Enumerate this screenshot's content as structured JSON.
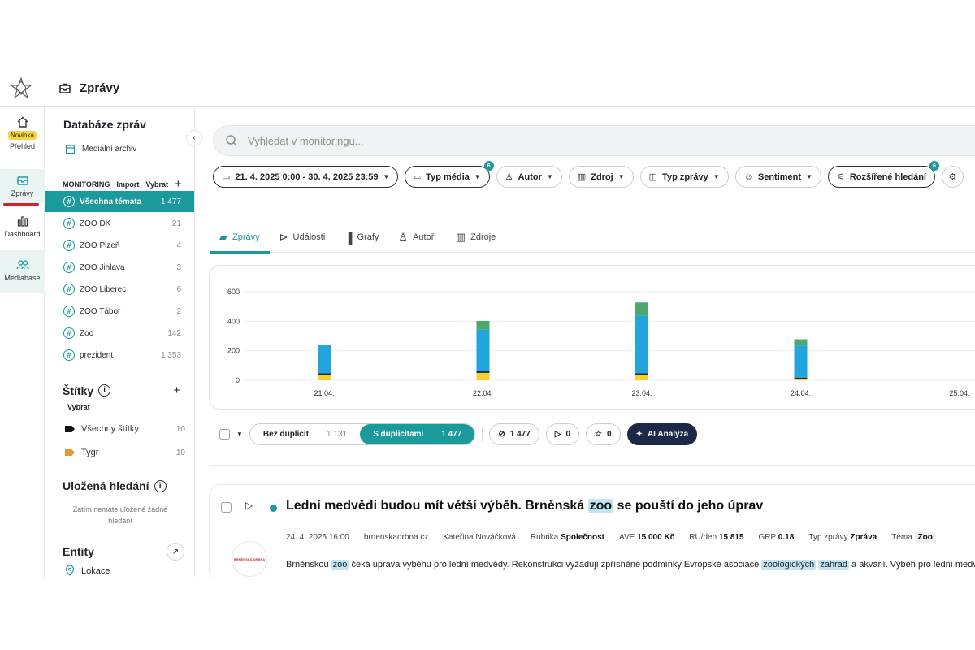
{
  "header": {
    "title": "Zprávy"
  },
  "rail": {
    "overview": {
      "label": "Přehled",
      "badge": "Novinka"
    },
    "messages": {
      "label": "Zprávy"
    },
    "dashboard": {
      "label": "Dashboard"
    },
    "mediabase": {
      "label": "Mediabase"
    }
  },
  "sidebar": {
    "db_title": "Databáze zpráv",
    "media_archive": "Mediální archiv",
    "monitoring_label": "MONITORING",
    "import_label": "Import",
    "select_label": "Vybrat",
    "topics": [
      {
        "label": "Všechna témata",
        "count": "1 477"
      },
      {
        "label": "ZOO DK",
        "count": "21"
      },
      {
        "label": "ZOO Plzeň",
        "count": "4"
      },
      {
        "label": "ZOO Jihlava",
        "count": "3"
      },
      {
        "label": "ZOO Liberec",
        "count": "6"
      },
      {
        "label": "ZOO Tábor",
        "count": "2"
      },
      {
        "label": "Zoo",
        "count": "142"
      },
      {
        "label": "prezident",
        "count": "1 353"
      }
    ],
    "labels_title": "Štítky",
    "labels_select": "Vybrat",
    "labels": [
      {
        "label": "Všechny štítky",
        "count": "10",
        "color": "#111111"
      },
      {
        "label": "Tygr",
        "count": "10",
        "color": "#e39b3a"
      }
    ],
    "saved_title": "Uložená hledání",
    "saved_empty_1": "Zatím nemáte uložené žádné",
    "saved_empty_2": "hledání",
    "entities_title": "Entity",
    "entities_location": "Lokace"
  },
  "search": {
    "placeholder": "Vyhledat v monitoringu..."
  },
  "filters": {
    "date_range": "21. 4. 2025 0:00 - 30. 4. 2025 23:59",
    "media_type": "Typ média",
    "media_type_count": "6",
    "author": "Autor",
    "source": "Zdroj",
    "message_type": "Typ zprávy",
    "sentiment": "Sentiment",
    "advanced": "Rozšířené hledání",
    "advanced_count": "6"
  },
  "tabs": [
    {
      "label": "Zprávy",
      "icon": "chat-icon"
    },
    {
      "label": "Události",
      "icon": "megaphone-icon"
    },
    {
      "label": "Grafy",
      "icon": "bar-chart-icon"
    },
    {
      "label": "Autoři",
      "icon": "user-icon"
    },
    {
      "label": "Zdroje",
      "icon": "building-icon"
    }
  ],
  "chart_data": {
    "type": "bar",
    "stacked": true,
    "categories": [
      "21.04.",
      "22.04.",
      "23.04.",
      "24.04.",
      "25.04."
    ],
    "yticks": [
      "0",
      "200",
      "400",
      "600"
    ],
    "ylim": [
      0,
      600
    ],
    "series": [
      {
        "color": "#f5d02f",
        "values": [
          35,
          50,
          35,
          10,
          0
        ]
      },
      {
        "color": "#1f2a44",
        "values": [
          12,
          12,
          12,
          8,
          0
        ]
      },
      {
        "color": "#22a4dd",
        "values": [
          195,
          280,
          390,
          215,
          0
        ]
      },
      {
        "color": "#4aa870",
        "values": [
          0,
          60,
          90,
          45,
          0
        ]
      }
    ]
  },
  "toolbar": {
    "no_duplicates": "Bez duplicit",
    "no_duplicates_count": "1 131",
    "with_duplicates": "S duplicitami",
    "with_duplicates_count": "1 477",
    "views": "1 477",
    "labels": "0",
    "stars": "0",
    "ai": "AI Analýza"
  },
  "article": {
    "title_1": "Lední medvědi budou mít větší výběh. Brněnská ",
    "title_hl": "zoo",
    "title_2": " se pouští do jeho úprav",
    "date": "24. 4. 2025 16:00",
    "source": "brnenskadrbna.cz",
    "author": "Kateřina Nováčková",
    "rubric_label": "Rubrika",
    "rubric": "Společnost",
    "ave_label": "AVE",
    "ave": "15 000 Kč",
    "ru_label": "RU/den",
    "ru": "15 815",
    "grp_label": "GRP",
    "grp": "0.18",
    "type_label": "Typ zprávy",
    "type": "Zpráva",
    "topic_label": "Téma",
    "topic": "Zoo",
    "snippet_1": "Brněnskou ",
    "snippet_hl1": "zoo",
    "snippet_2": " čeká úprava výběhu pro lední medvědy. Rekonstrukci vyžadují zpřísněné podmínky Evropské asociace ",
    "snippet_hl2": "zoologických",
    "snippet_3": " ",
    "snippet_hl3": "zahrad",
    "snippet_4": " a akvárií. Výběh pro lední medvědy",
    "source_logo_text": "BRNĚNSKÁ DRBNA"
  }
}
